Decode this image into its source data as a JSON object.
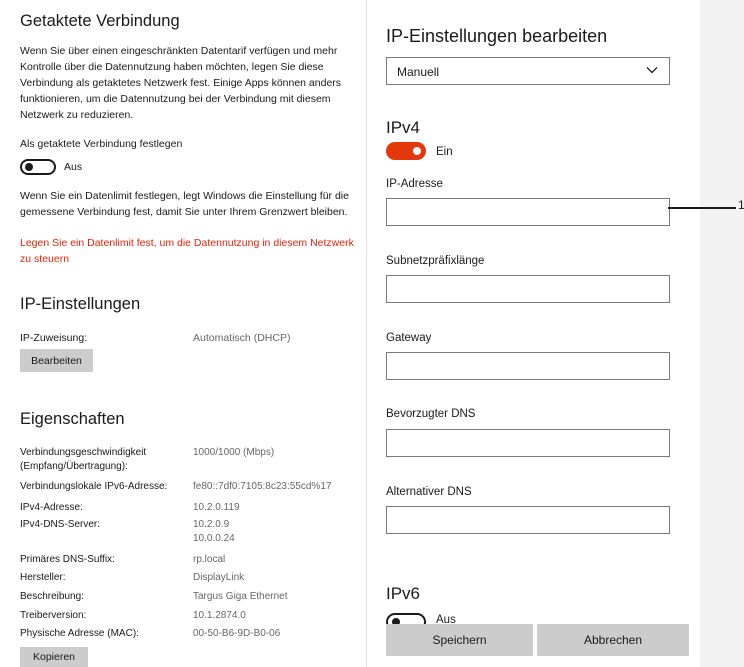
{
  "left": {
    "metered": {
      "title": "Getaktete Verbindung",
      "description": [
        "Wenn Sie über einen eingeschränkten Datentarif verfügen und mehr",
        "Kontrolle über die Datennutzung haben möchten, legen Sie diese",
        "Verbindung als getaktetes Netzwerk fest. Einige Apps können anders",
        "funktionieren, um die Datennutzung bei der Verbindung mit diesem",
        "Netzwerk zu reduzieren."
      ],
      "toggle_label": "Als getaktete Verbindung festlegen",
      "toggle_state": "Aus",
      "limit_info": [
        "Wenn Sie ein Datenlimit festlegen, legt Windows die Einstellung für die",
        "gemessene Verbindung fest, damit Sie unter Ihrem Grenzwert bleiben."
      ],
      "limit_link": [
        "Legen Sie ein Datenlimit fest, um die Datennutzung in diesem Netzwerk",
        "zu steuern"
      ]
    },
    "ip_settings": {
      "title": "IP-Einstellungen",
      "assignment_label": "IP-Zuweisung:",
      "assignment_value": "Automatisch (DHCP)",
      "edit_button": "Bearbeiten"
    },
    "properties": {
      "title": "Eigenschaften",
      "rows": [
        {
          "key": [
            "Verbindungsgeschwindigkeit",
            "(Empfang/Übertragung):"
          ],
          "value": [
            "1000/1000 (Mbps)"
          ]
        },
        {
          "key": [
            "Verbindungslokale IPv6-Adresse:"
          ],
          "value": [
            "fe80::7df0:7105:8c23:55cd%17"
          ]
        },
        {
          "key": [
            "IPv4-Adresse:"
          ],
          "value": [
            "10.2.0.119"
          ]
        },
        {
          "key": [
            "IPv4-DNS-Server:"
          ],
          "value": [
            "10.2.0.9",
            "10.0.0.24"
          ]
        },
        {
          "key": [
            "Primäres DNS-Suffix:"
          ],
          "value": [
            "rp.local"
          ]
        },
        {
          "key": [
            "Hersteller:"
          ],
          "value": [
            "DisplayLink"
          ]
        },
        {
          "key": [
            "Beschreibung:"
          ],
          "value": [
            "Targus Giga Ethernet"
          ]
        },
        {
          "key": [
            "Treiberversion:"
          ],
          "value": [
            "10.1.2874.0"
          ]
        },
        {
          "key": [
            "Physische Adresse (MAC):"
          ],
          "value": [
            "00-50-B6-9D-B0-06"
          ]
        }
      ],
      "copy_button": "Kopieren"
    }
  },
  "flyout": {
    "title": "IP-Einstellungen bearbeiten",
    "mode_select": "Manuell",
    "ipv4": {
      "heading": "IPv4",
      "toggle_state": "Ein",
      "fields": [
        {
          "label": "IP-Adresse",
          "value": ""
        },
        {
          "label": "Subnetzpräfixlänge",
          "value": ""
        },
        {
          "label": "Gateway",
          "value": ""
        },
        {
          "label": "Bevorzugter DNS",
          "value": ""
        },
        {
          "label": "Alternativer DNS",
          "value": ""
        }
      ]
    },
    "ipv6": {
      "heading": "IPv6",
      "toggle_state": "Aus"
    },
    "save_button": "Speichern",
    "cancel_button": "Abbrechen"
  },
  "callout": {
    "number": "1"
  },
  "colors": {
    "accent": "#e3380b",
    "warning": "#e3230b",
    "button_gray": "#cccccc"
  }
}
